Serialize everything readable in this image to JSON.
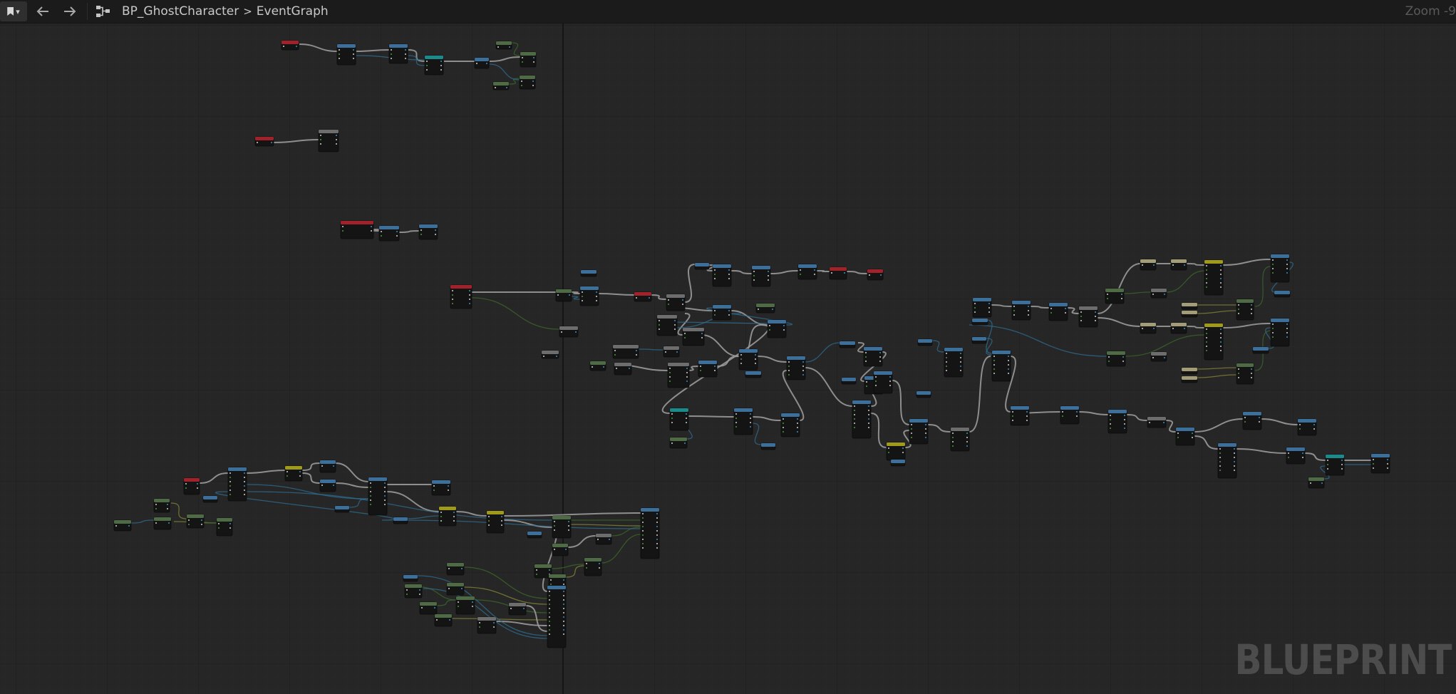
{
  "toolbar": {
    "bookmark_icon": "bookmark-icon",
    "chevron_icon": "chevron-down-icon",
    "back_icon": "arrow-left-icon",
    "forward_icon": "arrow-right-icon",
    "graph_icon": "blueprint-graph-icon"
  },
  "breadcrumb": {
    "blueprint": "BP_GhostCharacter",
    "separator": ">",
    "graph": "EventGraph"
  },
  "zoom": {
    "label": "Zoom -9"
  },
  "watermark": "BLUEPRINT",
  "colors": {
    "background": "#262626",
    "toolbar": "#1b1b1b",
    "event_node": "#a1222a",
    "function_node": "#3c6f99",
    "pure_node": "#4f6b45",
    "macro_node": "#6d6d6d",
    "flow_node": "#a09a1a",
    "teal_node": "#1a8a8a",
    "tan_node": "#a39c78",
    "exec_wire": "#9a9a9a",
    "object_wire": "#2f6f94",
    "vector_wire": "#8a8a3a",
    "bool_wire": "#3d6a2a"
  }
}
